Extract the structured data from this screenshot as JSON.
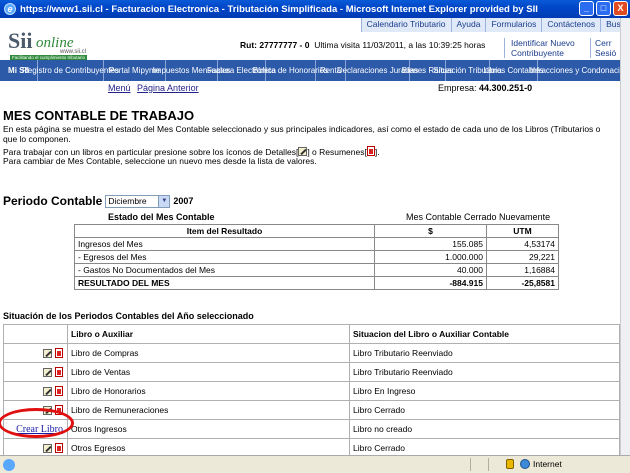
{
  "window": {
    "title": "https://www1.sii.cl - Facturacion Electronica - Tributación Simplificada - Microsoft Internet Explorer provided by SII",
    "minimize": "_",
    "maximize": "□",
    "close": "X"
  },
  "toplinks": [
    "Calendario Tributario",
    "Ayuda",
    "Formularios",
    "Contáctenos",
    "Busc"
  ],
  "logo": {
    "sii": "Sii",
    "online": "online",
    "www": "www.sii.cl",
    "tag": "Facilitando el cumplimiento tributario"
  },
  "session": {
    "rut_label": "Rut:",
    "rut": "27777777 - 0",
    "last_visit": "Ultima visita 11/03/2011, a las 10:39:25 horas",
    "identify_1": "Identificar Nuevo",
    "identify_2": "Contribuyente",
    "close_1": "Cerr",
    "close_2": "Sesió"
  },
  "nav": [
    {
      "label": "Mi SII",
      "w": 38
    },
    {
      "label": "Registro de Contribuyentes",
      "w": 66
    },
    {
      "label": "Portal Mipyme",
      "w": 62
    },
    {
      "label": "Impuestos Mensuales",
      "w": 52
    },
    {
      "label": "Factura Electrónica",
      "w": 48
    },
    {
      "label": "Boleta de Honorarios",
      "w": 50
    },
    {
      "label": "Renta",
      "w": 30
    },
    {
      "label": "Declaraciones Juradas",
      "w": 64
    },
    {
      "label": "Bienes Raíces",
      "w": 36
    },
    {
      "label": "Situación Tributaria",
      "w": 44
    },
    {
      "label": "Libros Contables",
      "w": 48
    },
    {
      "label": "Infracciones y Condonaciones",
      "w": 92
    }
  ],
  "links": {
    "menu": "Menú",
    "back": "Página Anterior"
  },
  "empresa": {
    "label": "Empresa:",
    "value": "44.300.251-0"
  },
  "page": {
    "title": "MES CONTABLE DE TRABAJO",
    "desc_1": "En esta página se muestra el estado del Mes Contable seleccionado y sus principales indicadores, así como el estado de cada uno de los Libros (Tributarios o",
    "desc_2": "que lo componen.",
    "instr_a": "Para trabajar con un libros en particular presione sobre los íconos de Detalles[",
    "instr_b": "] o Resumenes[",
    "instr_c": "].",
    "instr_2": "Para cambiar de Mes Contable, seleccione un nuevo mes desde la lista de valores."
  },
  "periodo": {
    "label": "Periodo Contable",
    "month": "Diciembre",
    "year": "2007"
  },
  "estado": {
    "label": "Estado del Mes Contable",
    "value": "Mes Contable Cerrado Nuevamente"
  },
  "resultados": {
    "headers": [
      "Item del Resultado",
      "$",
      "UTM"
    ],
    "rows": [
      [
        "Ingresos del Mes",
        "155.085",
        "4,53174"
      ],
      [
        "- Egresos del Mes",
        "1.000.000",
        "29,221"
      ],
      [
        "- Gastos No Documentados del Mes",
        "40.000",
        "1,16884"
      ]
    ],
    "total": [
      "RESULTADO DEL MES",
      "-884.915",
      "-25,8581"
    ]
  },
  "situacion": {
    "title": "Situación de los Periodos Contables del Año seleccionado",
    "headers": [
      "Libro o Auxiliar",
      "Situacion del Libro o Auxiliar Contable"
    ],
    "rows": [
      {
        "libro": "Libro de Compras",
        "estado": "Libro Tributario Reenviado",
        "create": false
      },
      {
        "libro": "Libro de Ventas",
        "estado": "Libro Tributario Reenviado",
        "create": false
      },
      {
        "libro": "Libro de Honorarios",
        "estado": "Libro En Ingreso",
        "create": false
      },
      {
        "libro": "Libro de Remuneraciones",
        "estado": "Libro Cerrado",
        "create": false
      },
      {
        "libro": "Otros Ingresos",
        "estado": "Libro no creado",
        "create": true
      },
      {
        "libro": "Otros Egresos",
        "estado": "Libro Cerrado",
        "create": false
      }
    ],
    "create_label": "Crear Libro"
  },
  "status": {
    "zone": "Internet"
  },
  "colors": {
    "nav": "#2c5aa8",
    "title_bar": "#0047c8",
    "highlight": "#e01010"
  }
}
